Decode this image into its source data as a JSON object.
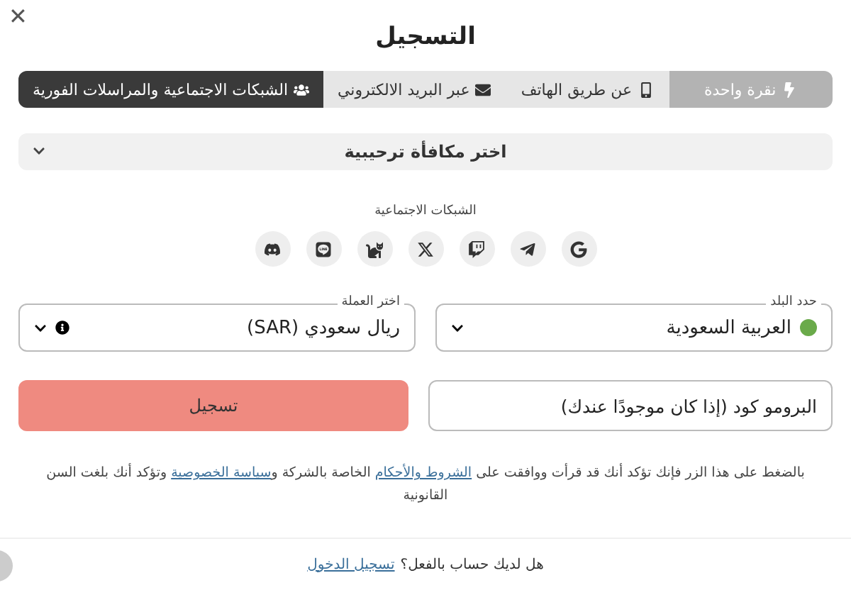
{
  "close": "✕",
  "title": "التسجيل",
  "tabs": [
    {
      "label": "نقرة واحدة",
      "kind": "click",
      "selected": false,
      "disabled": true
    },
    {
      "label": "عن طريق الهاتف",
      "kind": "phone",
      "selected": false,
      "disabled": false
    },
    {
      "label": "عبر البريد الالكتروني",
      "kind": "email",
      "selected": false,
      "disabled": false
    },
    {
      "label": "الشبكات الاجتماعية والمراسلات الفورية",
      "kind": "social",
      "selected": true,
      "disabled": false
    }
  ],
  "bonus": {
    "label": "اختر مكافأة ترحيبية",
    "expanded": false
  },
  "social": {
    "label": "الشبكات الاجتماعية",
    "buttons": [
      {
        "kind": "google"
      },
      {
        "kind": "telegram"
      },
      {
        "kind": "twitch"
      },
      {
        "kind": "x"
      },
      {
        "kind": "fox"
      },
      {
        "kind": "line"
      },
      {
        "kind": "discord"
      }
    ]
  },
  "country": {
    "label": "حدد البلد",
    "value": "العربية السعودية"
  },
  "currency": {
    "label": "اختر العملة",
    "value": "ريال سعودي (SAR)"
  },
  "promo": {
    "placeholder": "البرومو كود (إذا كان موجودًا عندك)"
  },
  "submit": "تسجيل",
  "terms": {
    "before": "بالضغط على هذا الزر فإنك تؤكد أنك قد قرأت ووافقت على",
    "link1": "الشروط والأحكام",
    "middle": "الخاصة بالشركة و",
    "link2": "سياسة الخصوصية",
    "after": "وتؤكد أنك بلغت السن القانونية"
  },
  "footer": {
    "question": "هل لديك حساب بالفعل؟",
    "link": "تسجيل الدخول"
  }
}
